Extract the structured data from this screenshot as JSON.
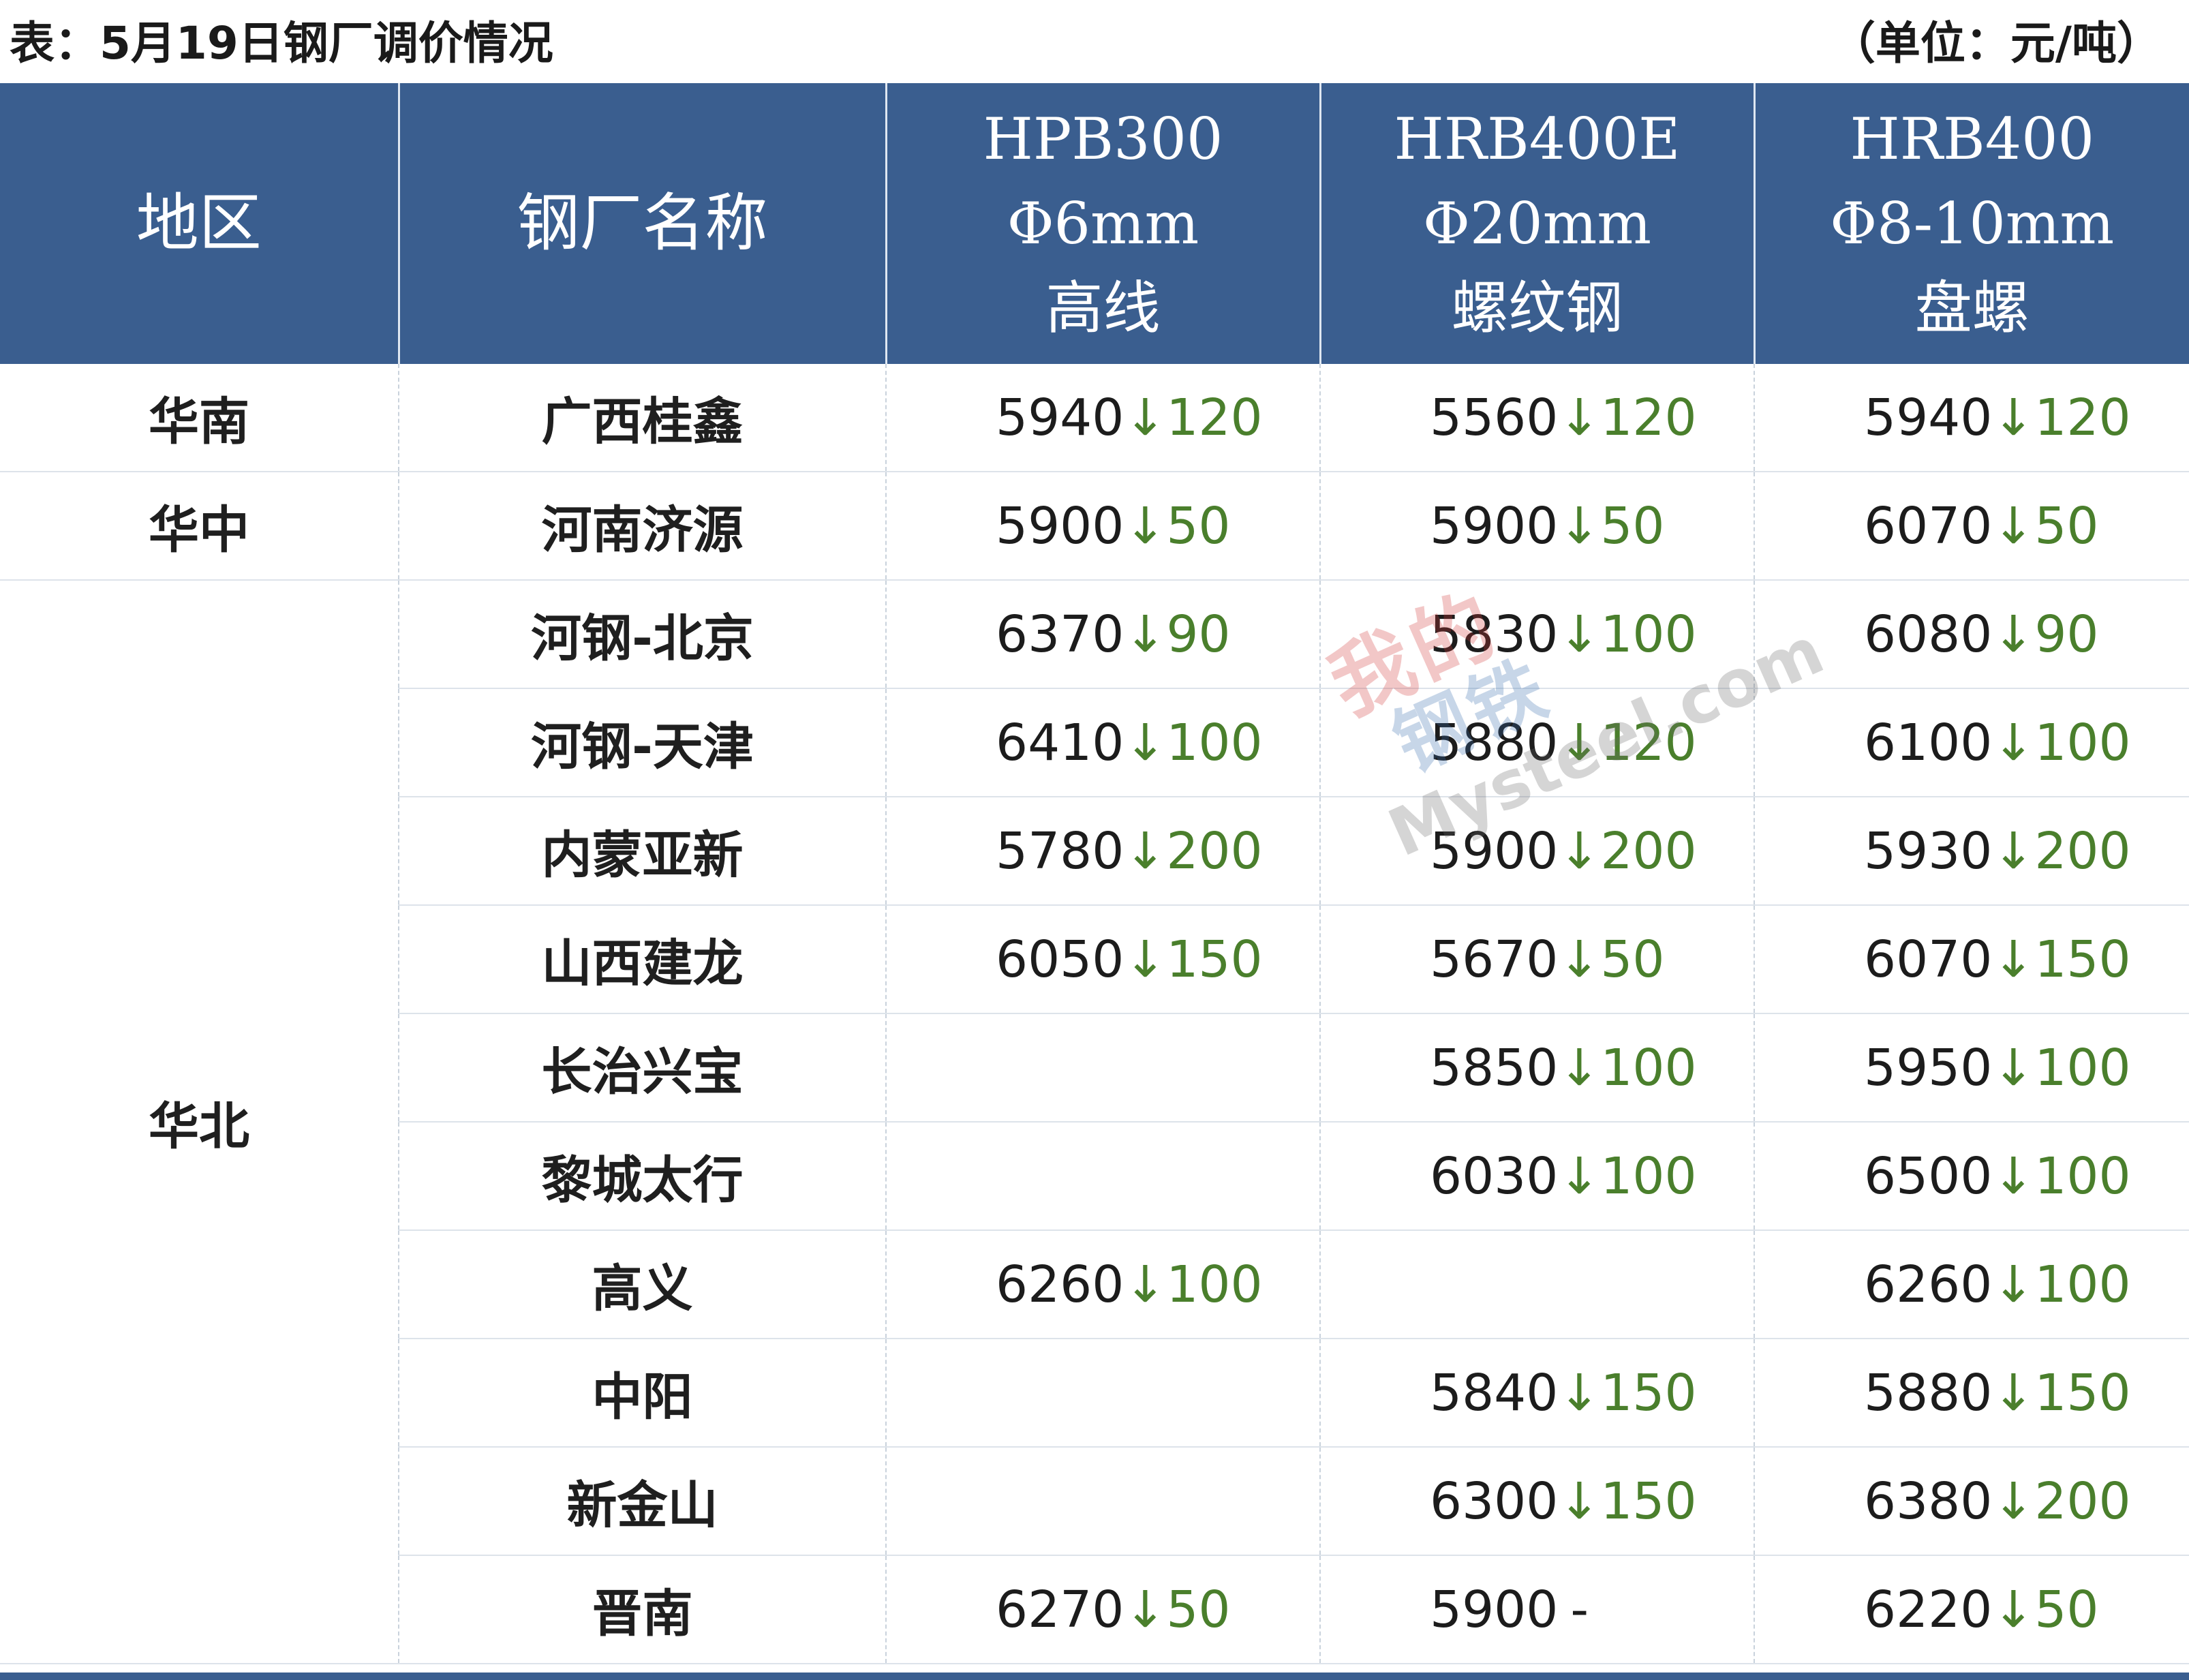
{
  "caption": {
    "title": "表：5月19日钢厂调价情况",
    "unit": "（单位：元/吨）"
  },
  "header": {
    "region": "地区",
    "mill": "钢厂名称",
    "p1": {
      "grade": "HPB300",
      "spec": "Φ6mm",
      "type": "高线"
    },
    "p2": {
      "grade": "HRB400E",
      "spec": "Φ20mm",
      "type": "螺纹钢"
    },
    "p3": {
      "grade": "HRB400",
      "spec": "Φ8-10mm",
      "type": "盘螺"
    }
  },
  "arrow_symbol": "↓",
  "rows": [
    {
      "region": "华南",
      "mill": "广西桂鑫",
      "p1": {
        "price": "5940",
        "change": "120"
      },
      "p2": {
        "price": "5560",
        "change": "120"
      },
      "p3": {
        "price": "5940",
        "change": "120"
      }
    },
    {
      "region": "华中",
      "mill": "河南济源",
      "p1": {
        "price": "5900",
        "change": "50"
      },
      "p2": {
        "price": "5900",
        "change": "50"
      },
      "p3": {
        "price": "6070",
        "change": "50"
      }
    },
    {
      "region": "华北",
      "mill": "河钢-北京",
      "p1": {
        "price": "6370",
        "change": "90"
      },
      "p2": {
        "price": "5830",
        "change": "100"
      },
      "p3": {
        "price": "6080",
        "change": "90"
      }
    },
    {
      "mill": "河钢-天津",
      "p1": {
        "price": "6410",
        "change": "100"
      },
      "p2": {
        "price": "5880",
        "change": "120"
      },
      "p3": {
        "price": "6100",
        "change": "100"
      }
    },
    {
      "mill": "内蒙亚新",
      "p1": {
        "price": "5780",
        "change": "200"
      },
      "p2": {
        "price": "5900",
        "change": "200"
      },
      "p3": {
        "price": "5930",
        "change": "200"
      }
    },
    {
      "mill": "山西建龙",
      "p1": {
        "price": "6050",
        "change": "150"
      },
      "p2": {
        "price": "5670",
        "change": "50"
      },
      "p3": {
        "price": "6070",
        "change": "150"
      }
    },
    {
      "mill": "长治兴宝",
      "p1": null,
      "p2": {
        "price": "5850",
        "change": "100"
      },
      "p3": {
        "price": "5950",
        "change": "100"
      }
    },
    {
      "mill": "黎城太行",
      "p1": null,
      "p2": {
        "price": "6030",
        "change": "100"
      },
      "p3": {
        "price": "6500",
        "change": "100"
      }
    },
    {
      "mill": "高义",
      "p1": {
        "price": "6260",
        "change": "100"
      },
      "p2": null,
      "p3": {
        "price": "6260",
        "change": "100"
      }
    },
    {
      "mill": "中阳",
      "p1": null,
      "p2": {
        "price": "5840",
        "change": "150"
      },
      "p3": {
        "price": "5880",
        "change": "150"
      }
    },
    {
      "mill": "新金山",
      "p1": null,
      "p2": {
        "price": "6300",
        "change": "150"
      },
      "p3": {
        "price": "6380",
        "change": "200"
      }
    },
    {
      "mill": "晋南",
      "p1": {
        "price": "6270",
        "change": "50"
      },
      "p2": {
        "price": "5900",
        "unchanged": "-"
      },
      "p3": {
        "price": "6220",
        "change": "50"
      }
    }
  ],
  "watermark": {
    "cn_top": "我的",
    "cn_bottom": "钢铁",
    "en": "Mysteel.com"
  },
  "colors": {
    "header_bg": "#3a5e8f",
    "change_green": "#4a7f2c"
  }
}
